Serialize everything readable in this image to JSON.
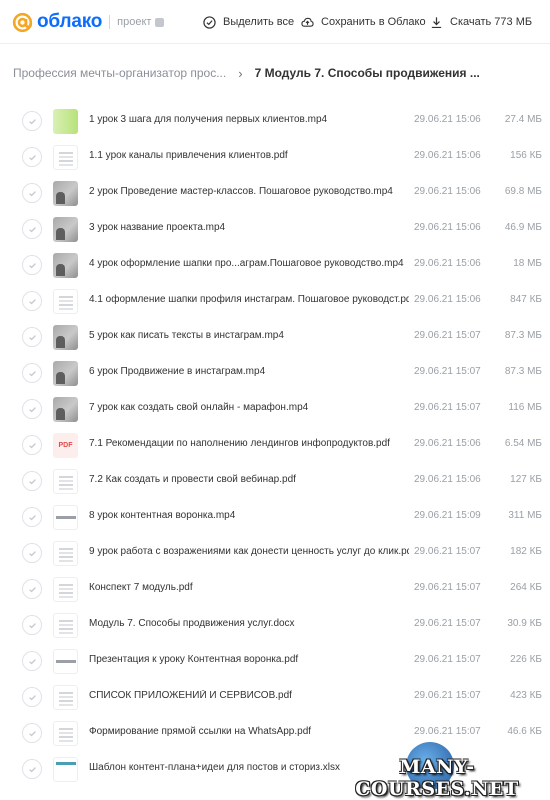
{
  "header": {
    "logo_text": "облако",
    "project_label": "проект",
    "select_all": "Выделить все",
    "save_to_cloud": "Сохранить в Облако",
    "download": "Скачать 773 МБ"
  },
  "breadcrumb": {
    "parent": "Профессия мечты-организатор прос...",
    "current": "7 Модуль 7. Способы продвижения ..."
  },
  "files": [
    {
      "name": "1 урок 3 шага для получения первых клиентов.mp4",
      "date": "29.06.21 15:06",
      "size": "27.4 МБ",
      "thumb": "green"
    },
    {
      "name": "1.1 урок каналы привлечения клиентов.pdf",
      "date": "29.06.21 15:06",
      "size": "156 КБ",
      "thumb": "doc"
    },
    {
      "name": "2 урок Проведение мастер-классов. Пошаговое руководство.mp4",
      "date": "29.06.21 15:06",
      "size": "69.8 МБ",
      "thumb": "video"
    },
    {
      "name": "3 урок название проекта.mp4",
      "date": "29.06.21 15:06",
      "size": "46.9 МБ",
      "thumb": "video"
    },
    {
      "name": "4 урок оформление шапки про...аграм.Пошаговое руководство.mp4",
      "date": "29.06.21 15:06",
      "size": "18 МБ",
      "thumb": "video"
    },
    {
      "name": "4.1 оформление шапки профиля инстаграм. Пошаговое руководст.pdf",
      "date": "29.06.21 15:06",
      "size": "847 КБ",
      "thumb": "doc"
    },
    {
      "name": "5 урок как писать тексты в инстаграм.mp4",
      "date": "29.06.21 15:07",
      "size": "87.3 МБ",
      "thumb": "video"
    },
    {
      "name": "6 урок Продвижение в инстаграм.mp4",
      "date": "29.06.21 15:07",
      "size": "87.3 МБ",
      "thumb": "video"
    },
    {
      "name": "7 урок как создать свой онлайн - марафон.mp4",
      "date": "29.06.21 15:07",
      "size": "116 МБ",
      "thumb": "video"
    },
    {
      "name": "7.1 Рекомендации по наполнению лендингов инфопродуктов.pdf",
      "date": "29.06.21 15:06",
      "size": "6.54 МБ",
      "thumb": "pdficon",
      "thumb_label": "PDF"
    },
    {
      "name": "7.2 Как создать и провести свой вебинар.pdf",
      "date": "29.06.21 15:06",
      "size": "127 КБ",
      "thumb": "doc"
    },
    {
      "name": "8 урок контентная воронка.mp4",
      "date": "29.06.21 15:09",
      "size": "311 МБ",
      "thumb": "strip"
    },
    {
      "name": "9 урок работа с возражениями как донести ценность услуг до клик.pdf",
      "date": "29.06.21 15:07",
      "size": "182 КБ",
      "thumb": "doc"
    },
    {
      "name": "Конспект 7 модуль.pdf",
      "date": "29.06.21 15:07",
      "size": "264 КБ",
      "thumb": "doc"
    },
    {
      "name": "Модуль 7. Способы продвижения услуг.docx",
      "date": "29.06.21 15:07",
      "size": "30.9 КБ",
      "thumb": "doc"
    },
    {
      "name": "Презентация к уроку Контентная воронка.pdf",
      "date": "29.06.21 15:07",
      "size": "226 КБ",
      "thumb": "strip"
    },
    {
      "name": "СПИСОК ПРИЛОЖЕНИЙ И СЕРВИСОВ.pdf",
      "date": "29.06.21 15:07",
      "size": "423 КБ",
      "thumb": "doc"
    },
    {
      "name": "Формирование прямой ссылки на WhatsApp.pdf",
      "date": "29.06.21 15:07",
      "size": "46.6 КБ",
      "thumb": "doc"
    },
    {
      "name": "Шаблон контент-плана+идеи для постов и сториз.xlsx",
      "date": "",
      "size": "",
      "thumb": "xls"
    }
  ],
  "watermark": "MANY-COURSES.NET"
}
